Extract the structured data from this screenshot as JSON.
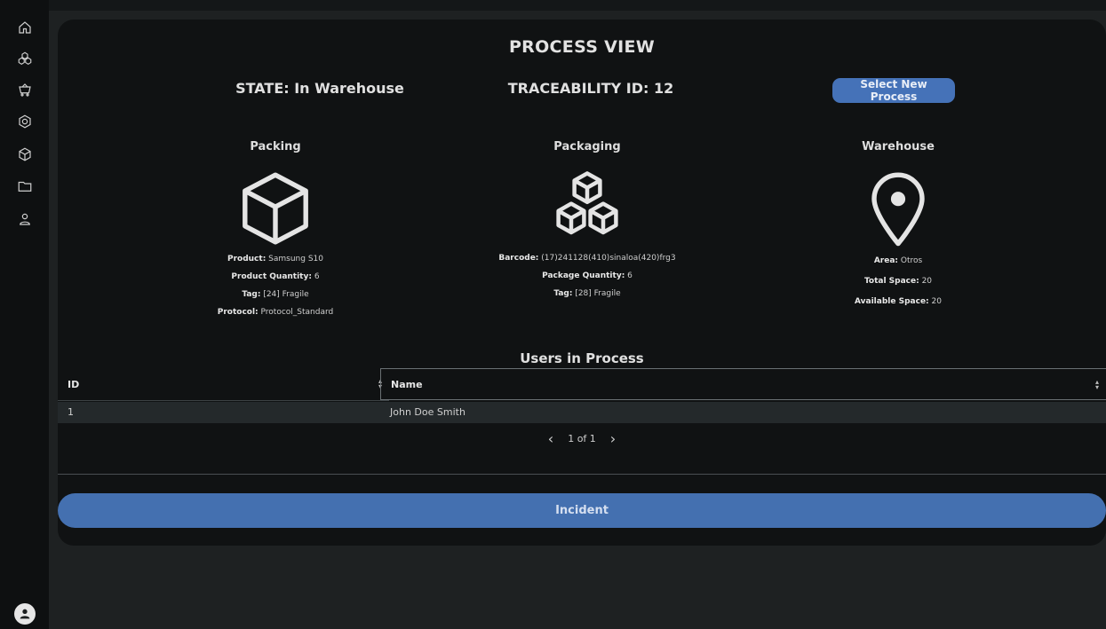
{
  "sidebar": {
    "icons": [
      "home-icon",
      "boxes-icon",
      "cart-icon",
      "hexagon-icon",
      "box-icon",
      "folder-icon",
      "user-icon"
    ],
    "avatar": "account-avatar-icon"
  },
  "header": {
    "title": "PROCESS VIEW",
    "state": "STATE: In Warehouse",
    "traceability": "TRACEABILITY ID: 12",
    "select_button": "Select New Process"
  },
  "stages": {
    "packing": {
      "title": "Packing",
      "icon": "cube-icon",
      "fields": [
        {
          "label": "Product:",
          "value": " Samsung S10"
        },
        {
          "label": "Product Quantity:",
          "value": " 6"
        },
        {
          "label": "Tag:",
          "value": " [24] Fragile"
        },
        {
          "label": "Protocol:",
          "value": " Protocol_Standard"
        }
      ]
    },
    "packaging": {
      "title": "Packaging",
      "icon": "stacked-boxes-icon",
      "fields": [
        {
          "label": "Barcode:",
          "value": " (17)241128(410)sinaloa(420)frg3"
        },
        {
          "label": "Package Quantity:",
          "value": " 6"
        },
        {
          "label": "Tag:",
          "value": " [28] Fragile"
        }
      ]
    },
    "warehouse": {
      "title": "Warehouse",
      "icon": "location-pin-icon",
      "fields": [
        {
          "label": "Area:",
          "value": " Otros"
        },
        {
          "label": "Total Space:",
          "value": " 20"
        },
        {
          "label": "Available Space:",
          "value": " 20"
        }
      ]
    }
  },
  "users": {
    "title": "Users in Process",
    "columns": [
      "ID",
      "Name"
    ],
    "rows": [
      {
        "id": "1",
        "name": "John Doe Smith"
      }
    ],
    "pager": {
      "prev": "‹",
      "label": "1 of 1",
      "next": "›"
    }
  },
  "incident_button": "Incident",
  "colors": {
    "accent": "#4572b8",
    "card_bg": "#101213",
    "page_bg": "#1e2122",
    "sidebar_bg": "#0e1011"
  }
}
